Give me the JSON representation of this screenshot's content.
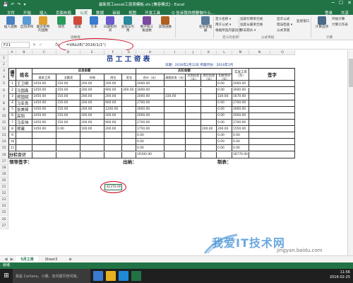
{
  "window": {
    "title": "最新员工excel工资表模板.xls [兼容模式] - Excel",
    "qa_items": [
      "💾",
      "↶",
      "↷",
      "▾"
    ],
    "min": "─",
    "max": "☐",
    "close": "✕"
  },
  "ribbon_tabs": [
    "文件",
    "开始",
    "插入",
    "页面布局",
    "公式",
    "数据",
    "审阅",
    "视图",
    "开发工具",
    "Q 告诉我你想要做什么...",
    "登录",
    "共享"
  ],
  "active_tab_index": 4,
  "ribbon": {
    "big_buttons": [
      {
        "label": "插入函数",
        "color": "#4a7fc1"
      },
      {
        "label": "自动求和",
        "color": "#5a9bd5"
      },
      {
        "label": "最近使用的函数",
        "color": "#e0a030"
      },
      {
        "label": "财务",
        "color": "#2a9a5a"
      },
      {
        "label": "逻辑",
        "color": "#d04a3a"
      },
      {
        "label": "文本",
        "color": "#3a7ad0"
      },
      {
        "label": "日期和时间",
        "color": "#6a5acd"
      },
      {
        "label": "查找与引用",
        "color": "#2a8a9a"
      },
      {
        "label": "数学和三角函数",
        "color": "#7a4aa0"
      },
      {
        "label": "其他函数",
        "color": "#b06020"
      },
      {
        "label": "名称管理器",
        "color": "#5a7a9a"
      },
      {
        "label": "计算选项",
        "color": "#4a6a8a"
      }
    ],
    "small_items": [
      "定义名称 ▾",
      "用于公式 ▾",
      "根据所选内容创建",
      "追踪引用单元格",
      "追踪从属单元格",
      "移去箭头 ▾",
      "显示公式",
      "错误检查 ▾",
      "公式求值",
      "监视窗口",
      "开始计算",
      "计算工作表"
    ],
    "groups": [
      "函数库",
      "定义的名称",
      "公式审核",
      "计算"
    ]
  },
  "formula_bar": {
    "name_box": "F21",
    "fx": "fx",
    "formula": "=VALUE(\"2016/1/1\")"
  },
  "columns": [
    "A",
    "B",
    "C",
    "D",
    "E",
    "F",
    "G",
    "H",
    "I",
    "J",
    "K",
    "L",
    "M",
    "N",
    "O"
  ],
  "rows": [
    "1",
    "2",
    "3",
    "4",
    "5",
    "6",
    "7",
    "8",
    "9",
    "10",
    "11",
    "12",
    "13",
    "14",
    "15",
    "16",
    "17",
    "18",
    "19",
    "20",
    "21",
    "22",
    "23",
    "24",
    "25",
    "26",
    "27"
  ],
  "sheet": {
    "title": "员工工资表",
    "date_line": "日期：2016年2月12日  所属月份：2016年1月",
    "header": {
      "num": "编号",
      "name": "姓名",
      "should_pay": "应发金额",
      "deduct": "应扣金额",
      "basic": "基本工资",
      "bonus": "全勤奖",
      "subsidy": "补助",
      "post": "岗位",
      "award": "奖金",
      "total": "合计（元）",
      "leave": "请假扣发（元）",
      "late": "迟到扣发（元）",
      "other": "其它扣发（元）",
      "deduct_total": "扣款合计（元）",
      "real": "实发工资（元）",
      "sign": "签字"
    },
    "rows": [
      {
        "num": "1",
        "name": "王卫明",
        "v": [
          "1450.00",
          "150.00",
          "200.00",
          "200.00",
          "",
          "2000.00",
          "",
          "",
          "",
          "0.00",
          "2000.00"
        ]
      },
      {
        "num": "2",
        "name": "马国鑫",
        "v": [
          "1450.00",
          "150.00",
          "200.00",
          "900.00",
          "300.00",
          "3000.00",
          "",
          "",
          "",
          "0.00",
          "3000.00"
        ]
      },
      {
        "num": "3",
        "name": "郑国斌",
        "v": [
          "1450.00",
          "150.00",
          "200.00",
          "200.00",
          "",
          "2000.00",
          "330.00",
          "",
          "",
          "330.00",
          "1670.00"
        ]
      },
      {
        "num": "4",
        "name": "马亚良",
        "v": [
          "1450.00",
          "150.00",
          "200.00",
          "900.00",
          "",
          "2700.00",
          "",
          "",
          "",
          "0.00",
          "2700.00"
        ]
      },
      {
        "num": "5",
        "name": "张美琴",
        "v": [
          "1450.00",
          "150.00",
          "200.00",
          "1200.00",
          "",
          "3000.00",
          "",
          "",
          "",
          "0.00",
          "3000.00"
        ]
      },
      {
        "num": "6",
        "name": "高阳",
        "v": [
          "1450.00",
          "150.00",
          "200.00",
          "200.00",
          "",
          "2000.00",
          "",
          "",
          "",
          "0.00",
          "2000.00"
        ]
      },
      {
        "num": "7",
        "name": "马亚伟",
        "v": [
          "1450.00",
          "150.00",
          "200.00",
          "900.00",
          "",
          "2700.00",
          "",
          "",
          "",
          "0.00",
          "2700.00"
        ]
      },
      {
        "num": "8",
        "name": "郑庸",
        "v": [
          "1450.00",
          "0.00",
          "100.00",
          "200.00",
          "",
          "1750.00",
          "",
          "",
          "200.00",
          "200.00",
          "1550.00"
        ]
      },
      {
        "num": "9",
        "name": "",
        "v": [
          "",
          "",
          "",
          "",
          "",
          "0.00",
          "",
          "",
          "",
          "0.00",
          "0.00"
        ]
      },
      {
        "num": "10",
        "name": "",
        "v": [
          "",
          "",
          "",
          "",
          "",
          "0.00",
          "",
          "",
          "",
          "0.00",
          "0.00"
        ]
      },
      {
        "num": "11",
        "name": "",
        "v": [
          "",
          "",
          "",
          "",
          "",
          "0.00",
          "",
          "",
          "",
          "0.00",
          "0.00"
        ]
      }
    ],
    "total_label": "分栏合计",
    "total_sum": "19300.00",
    "total_real": "18770.00",
    "sign_leader": "领导签字：",
    "sign_cashier": "出纳：",
    "sign_maker": "制表：",
    "f21_value": "42370.00"
  },
  "sheet_tabs": [
    "5月工资",
    "Sheet3",
    "⊕"
  ],
  "status": "就绪",
  "taskbar": {
    "search": "我是 Cortana，小娜。有问题尽管问我。",
    "time": "11:56",
    "date": "2016-02-25"
  },
  "watermark": "我爱IT技术网",
  "watermark_url": "jingyan.baidu.com"
}
